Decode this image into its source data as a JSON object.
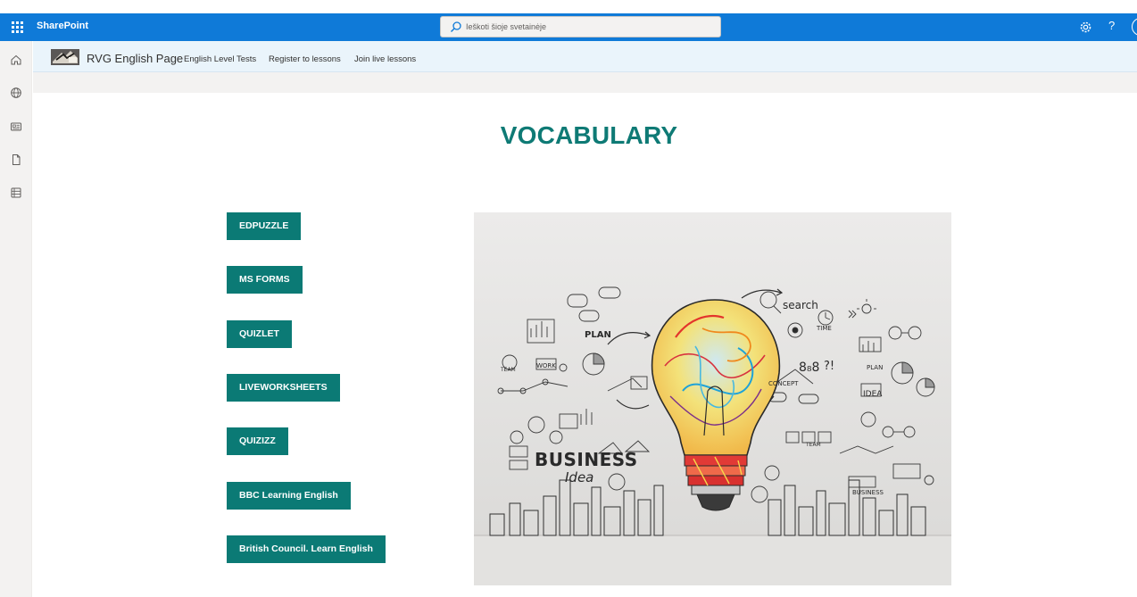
{
  "suite_bar": {
    "brand": "SharePoint",
    "search_placeholder": "Ieškoti šioje svetainėje",
    "help_label": "?"
  },
  "site_header": {
    "title": "RVG English Page",
    "nav": [
      {
        "label": "English Level Tests"
      },
      {
        "label": "Register to lessons"
      },
      {
        "label": "Join live lessons"
      }
    ]
  },
  "main": {
    "title": "VOCABULARY",
    "buttons": [
      {
        "label": "EDPUZZLE"
      },
      {
        "label": "MS FORMS"
      },
      {
        "label": "QUIZLET"
      },
      {
        "label": "LIVEWORKSHEETS"
      },
      {
        "label": "QUIZIZZ"
      },
      {
        "label": "BBC Learning English"
      },
      {
        "label": "British Council. Learn English"
      }
    ],
    "image": {
      "words": [
        "search",
        "TIME",
        "PLAN",
        "WORK",
        "TEAM",
        "BUSINESS",
        "Idea",
        "IDEA",
        "CONCEPT",
        "?!"
      ]
    }
  },
  "colors": {
    "suite_bar": "#0f7ad8",
    "accent": "#0b7a75",
    "title": "#0e7a75",
    "rail": "#f3f2f1",
    "site_header": "#eaf4fb"
  },
  "rail_icons": [
    "home-icon",
    "globe-icon",
    "news-icon",
    "file-icon",
    "list-icon"
  ]
}
